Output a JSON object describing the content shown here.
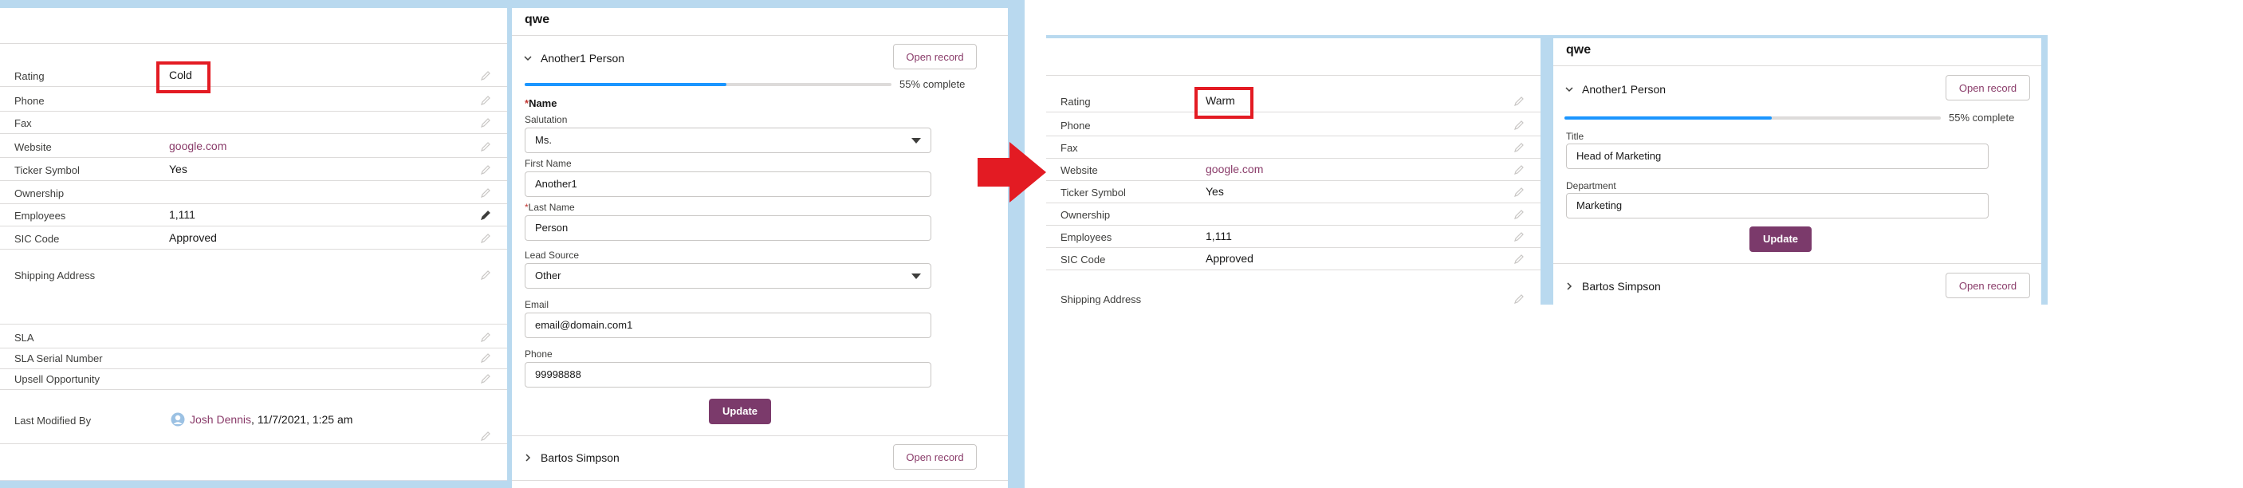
{
  "before": {
    "record": {
      "fields": [
        {
          "label": "Rating",
          "value": "Cold"
        },
        {
          "label": "Phone",
          "value": ""
        },
        {
          "label": "Fax",
          "value": ""
        },
        {
          "label": "Website",
          "value": "google.com"
        },
        {
          "label": "Ticker Symbol",
          "value": "Yes"
        },
        {
          "label": "Ownership",
          "value": ""
        },
        {
          "label": "Employees",
          "value": "1,111"
        },
        {
          "label": "SIC Code",
          "value": "Approved"
        },
        {
          "label": "Shipping Address",
          "value": ""
        },
        {
          "label": "SLA",
          "value": ""
        },
        {
          "label": "SLA Serial Number",
          "value": ""
        },
        {
          "label": "Upsell Opportunity",
          "value": ""
        }
      ],
      "last_modified": {
        "label": "Last Modified By",
        "user": "Josh Dennis",
        "datetime": ", 11/7/2021, 1:25 am"
      }
    },
    "flow": {
      "title": "qwe",
      "section1": {
        "name": "Another1 Person",
        "open_label": "Open record"
      },
      "progress": {
        "percent": 55,
        "label": "55% complete"
      },
      "form": {
        "name_section": "Name",
        "salutation_label": "Salutation",
        "salutation_value": "Ms.",
        "first_name_label": "First Name",
        "first_name_value": "Another1",
        "last_name_label": "Last Name",
        "last_name_value": "Person",
        "lead_source_label": "Lead Source",
        "lead_source_value": "Other",
        "email_label": "Email",
        "email_value": "email@domain.com1",
        "phone_label": "Phone",
        "phone_value": "99998888",
        "update_label": "Update"
      },
      "section2": {
        "name": "Bartos Simpson",
        "open_label": "Open record"
      }
    }
  },
  "after": {
    "record": {
      "fields": [
        {
          "label": "Rating",
          "value": "Warm"
        },
        {
          "label": "Phone",
          "value": ""
        },
        {
          "label": "Fax",
          "value": ""
        },
        {
          "label": "Website",
          "value": "google.com"
        },
        {
          "label": "Ticker Symbol",
          "value": "Yes"
        },
        {
          "label": "Ownership",
          "value": ""
        },
        {
          "label": "Employees",
          "value": "1,111"
        },
        {
          "label": "SIC Code",
          "value": "Approved"
        },
        {
          "label": "Shipping Address",
          "value": ""
        }
      ]
    },
    "flow": {
      "title": "qwe",
      "section1": {
        "name": "Another1 Person",
        "open_label": "Open record"
      },
      "progress": {
        "percent": 55,
        "label": "55% complete"
      },
      "form": {
        "title_label": "Title",
        "title_value": "Head of Marketing",
        "department_label": "Department",
        "department_value": "Marketing",
        "update_label": "Update"
      },
      "section2": {
        "name": "Bartos Simpson",
        "open_label": "Open record"
      }
    }
  },
  "colors": {
    "accent": "#8a3c6a",
    "button": "#7b3a6b",
    "progress": "#1b96ff",
    "highlight": "#e31b23",
    "arrow": "#e31b23"
  }
}
